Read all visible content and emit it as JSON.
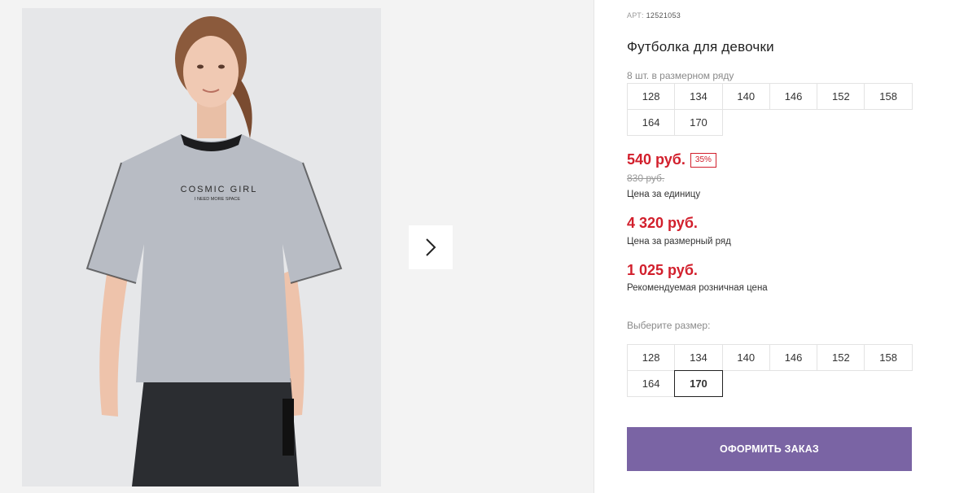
{
  "product": {
    "art_label": "АРТ:",
    "art_number": "12521053",
    "title": "Футболка для девочки",
    "pack_info": "8 шт. в размерном ряду",
    "image_name": "girl-in-tshirt-photo",
    "tshirt_print_line1": "COSMIC GIRL",
    "tshirt_print_line2": "I NEED MORE SPACE"
  },
  "size_series": [
    "128",
    "134",
    "140",
    "146",
    "152",
    "158",
    "164",
    "170"
  ],
  "prices": {
    "unit_price": "540 руб.",
    "discount": "35%",
    "old_price": "830 руб.",
    "unit_label": "Цена за единицу",
    "series_price": "4 320 руб.",
    "series_label": "Цена за размерный ряд",
    "retail_price": "1 025 руб.",
    "retail_label": "Рекомендуемая розничная цена"
  },
  "size_select": {
    "label": "Выберите размер:",
    "options": [
      "128",
      "134",
      "140",
      "146",
      "152",
      "158",
      "164",
      "170"
    ],
    "selected": "170"
  },
  "order_button": "ОФОРМИТЬ ЗАКАЗ",
  "icons": {
    "next": "chevron-right-icon"
  },
  "colors": {
    "price_red": "#d21f2c",
    "button_purple": "#7a64a4"
  }
}
